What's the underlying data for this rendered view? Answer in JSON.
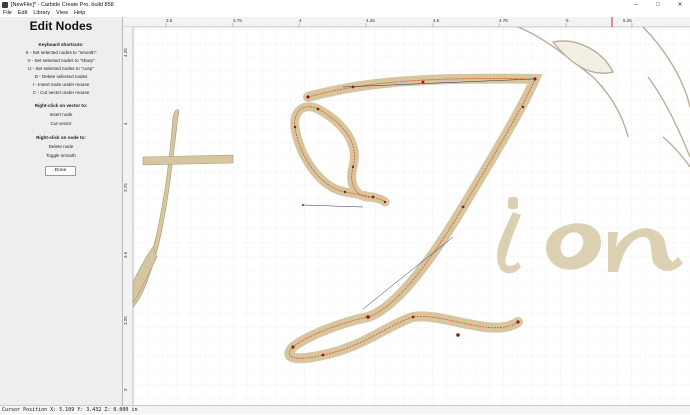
{
  "window": {
    "title": "[NewFile]* - Carbide Create Pro, build 858",
    "minimize": "–",
    "maximize": "□",
    "close": "✕"
  },
  "menu": [
    "File",
    "Edit",
    "Library",
    "View",
    "Help"
  ],
  "panel": {
    "title": "Edit Nodes",
    "keyboard_heading": "Keyboard shortcuts:",
    "shortcuts": [
      "S - Set selected nodes to \"smooth\"",
      "V - Set selected nodes to \"sharp\"",
      "U - Set selected nodes to \"cusp\"",
      "D - Delete selected nodes",
      "I - Insert node under mouse",
      "C - Cut vector under mouse"
    ],
    "vector_heading": "Right-click on vector to:",
    "vector_actions": [
      "Insert node",
      "Cut vector"
    ],
    "node_heading": "Right-click on node to:",
    "node_actions": [
      "Delete node",
      "Toggle smooth"
    ],
    "done_label": "Done"
  },
  "ruler": {
    "top_labels": [
      "3.5",
      "3.75",
      "4",
      "4.25",
      "4.5",
      "4.75",
      "5",
      "5.25"
    ],
    "left_labels": [
      "4.25",
      "4",
      "3.75",
      "3.5",
      "3.25",
      "3"
    ]
  },
  "status": {
    "text": "Cursor Position X: 5.109 Y: 3.432 Z: 0.000 in"
  },
  "colors": {
    "fill": "#d6c6a0",
    "path": "#e2541e",
    "node": "#8a1f12",
    "handle": "#2b2b6a",
    "grid": "#e8e8e8",
    "ruler_marker": "#c4322a"
  }
}
